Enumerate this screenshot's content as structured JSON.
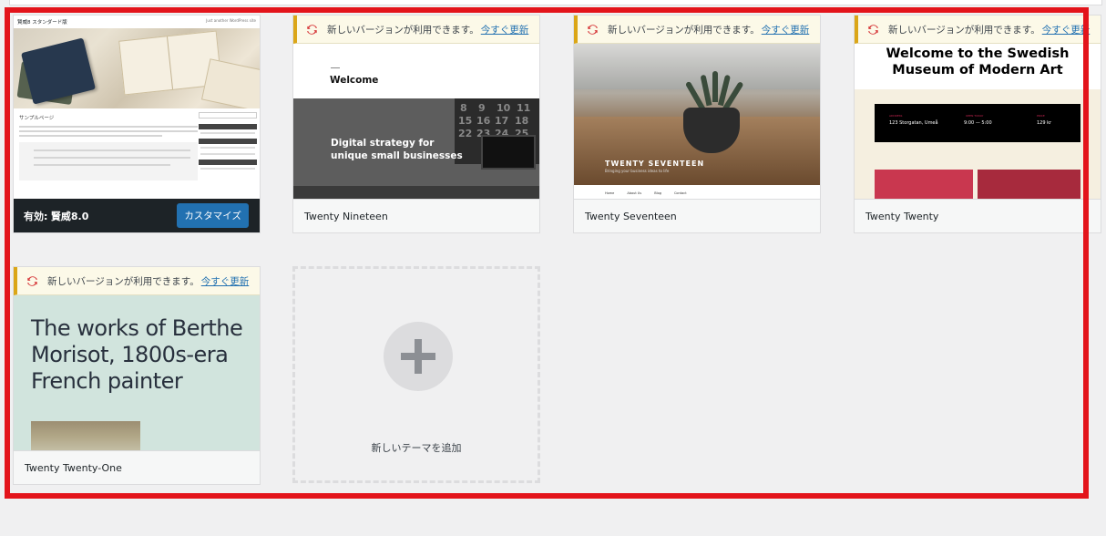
{
  "active_theme": {
    "header_title": "賢威8 スタンダード版",
    "header_right": "Just another WordPress site",
    "page_heading": "サンプルページ",
    "active_prefix": "有効:",
    "active_name": "賢威8.0",
    "customize_label": "カスタマイズ"
  },
  "update_notice": {
    "text": "新しいバージョンが利用できます。",
    "link": "今すぐ更新"
  },
  "themes": [
    {
      "name": "Twenty Nineteen",
      "preview_heading": "Welcome",
      "preview_tagline_1": "Digital strategy for",
      "preview_tagline_2": "unique small businesses"
    },
    {
      "name": "Twenty Seventeen",
      "preview_title": "TWENTY SEVENTEEN",
      "preview_sub": "Bringing your business ideas to life"
    },
    {
      "name": "Twenty Twenty",
      "preview_title_1": "Welcome to the Swedish",
      "preview_title_2": "Museum of Modern Art",
      "info_1": "123 Storgatan, Umeå",
      "info_2": "9:00 — 5:00",
      "info_3": "129 kr",
      "label_1": "ADDRESS",
      "label_2": "OPEN TODAY",
      "label_3": "PRICE"
    },
    {
      "name": "Twenty Twenty-One",
      "preview_line_1": "The works of Berthe",
      "preview_line_2": "Morisot, 1800s-era",
      "preview_line_3": "French painter"
    }
  ],
  "add_new": {
    "label": "新しいテーマを追加"
  },
  "colors": {
    "highlight": "#e3141b",
    "link": "#2271b1",
    "notice_border": "#dba617",
    "update_icon": "#d63638"
  }
}
